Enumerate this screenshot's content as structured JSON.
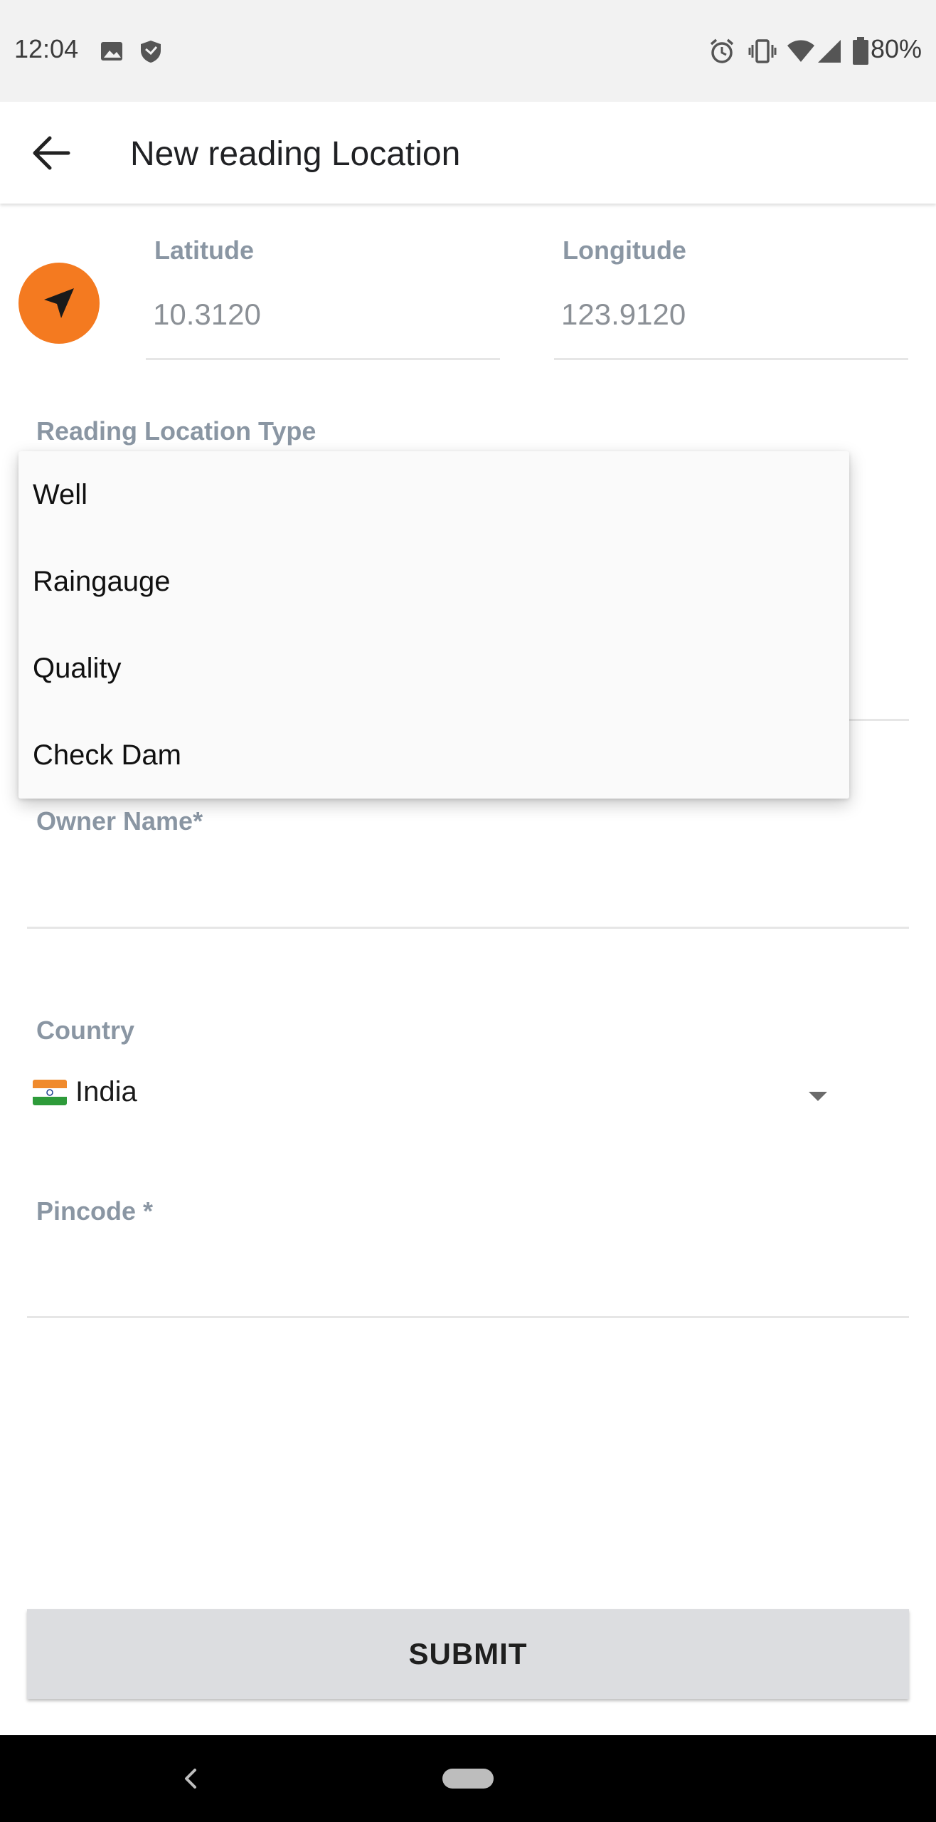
{
  "status_bar": {
    "time": "12:04",
    "battery": "80%",
    "icons": [
      "image-icon",
      "shield-icon",
      "alarm-icon",
      "vibrate-icon",
      "wifi-icon",
      "signal-icon",
      "battery-icon"
    ]
  },
  "app_bar": {
    "title": "New reading Location",
    "back_icon": "arrow-left-icon"
  },
  "location": {
    "latitude_label": "Latitude",
    "latitude_value": "10.3120",
    "longitude_label": "Longitude",
    "longitude_value": "123.9120",
    "locate_icon": "navigation-arrow-icon",
    "accent_color": "#f47a20"
  },
  "reading_location_type": {
    "label": "Reading Location Type",
    "options": [
      "Well",
      "Raingauge",
      "Quality",
      "Check Dam"
    ]
  },
  "owner": {
    "label": "Owner Name*"
  },
  "country": {
    "label": "Country",
    "value": "India",
    "flag_icon": "india-flag-icon"
  },
  "pincode": {
    "label": "Pincode *"
  },
  "submit": {
    "label": "SUBMIT"
  }
}
